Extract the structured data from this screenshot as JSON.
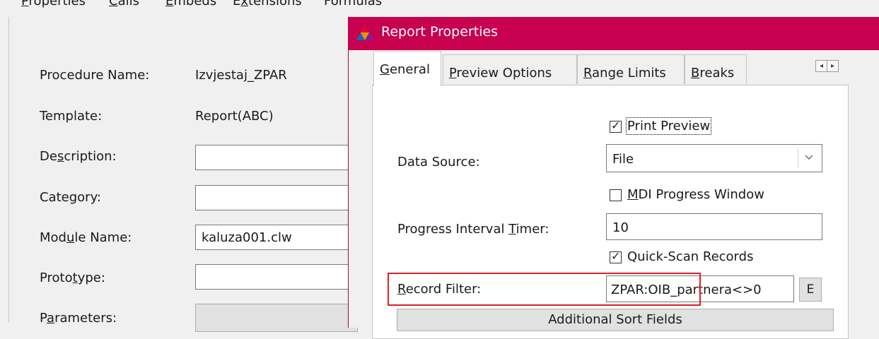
{
  "background_window": {
    "tabs": [
      "Properties",
      "Calls",
      "Embeds",
      "Extensions",
      "Formulas"
    ],
    "fields": {
      "procedure_name": {
        "label": "Procedure Name:",
        "value": "Izvjestaj_ZPAR"
      },
      "template": {
        "label": "Template:",
        "value": "Report(ABC)"
      },
      "description": {
        "label": "Description:",
        "value": ""
      },
      "category": {
        "label": "Category:",
        "value": ""
      },
      "module_name": {
        "label": "Module Name:",
        "value": "kaluza001.clw"
      },
      "prototype": {
        "label": "Prototype:",
        "value": ""
      },
      "parameters": {
        "label": "Parameters:"
      }
    }
  },
  "dialog": {
    "title": "Report Properties",
    "title_color": "#c7004f",
    "tabs": [
      "General",
      "Preview Options",
      "Range Limits",
      "Breaks"
    ],
    "active_tab": "General",
    "scroll_arrows": [
      "◂",
      "▸"
    ],
    "print_preview": {
      "label": "Print Preview",
      "checked": true
    },
    "data_source": {
      "label": "Data Source:",
      "value": "File",
      "icon": "chevron-down-icon"
    },
    "mdi_progress": {
      "label": "MDI Progress Window",
      "checked": false
    },
    "progress_timer": {
      "label": "Progress Interval Timer:",
      "value": "10"
    },
    "quick_scan": {
      "label": "Quick-Scan Records",
      "checked": true
    },
    "record_filter": {
      "label": "Record Filter:",
      "value": "ZPAR:OIB_partnera<>0",
      "button": "E",
      "highlight_color": "#e0202a"
    },
    "additional_sort": {
      "label": "Additional Sort Fields"
    }
  }
}
